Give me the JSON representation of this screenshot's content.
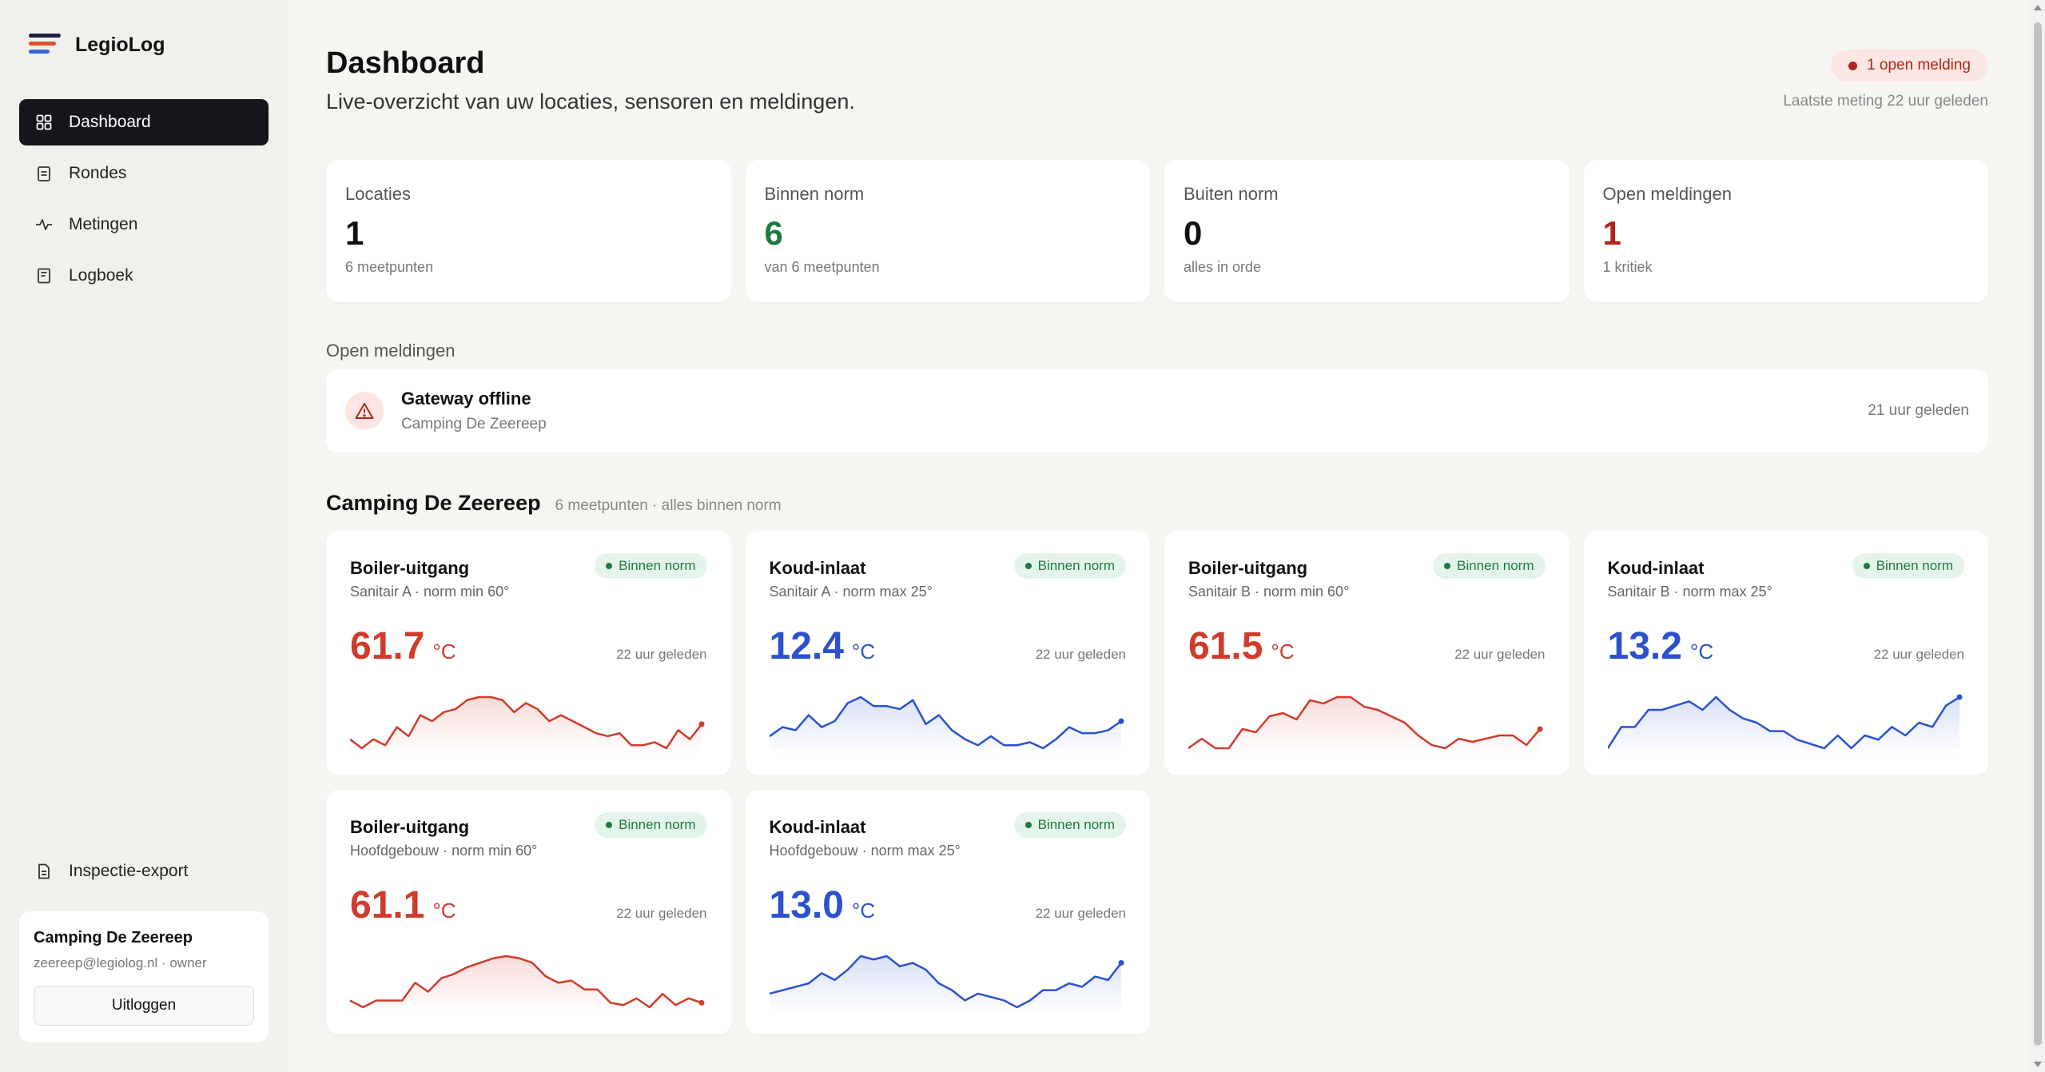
{
  "app": {
    "name": "LegioLog",
    "logo_colors": [
      "#1b1f3b",
      "#e0502f",
      "#3a63d6"
    ]
  },
  "sidebar": {
    "items": [
      {
        "label": "Dashboard",
        "icon": "grid-icon",
        "active": true
      },
      {
        "label": "Rondes",
        "icon": "clipboard-icon",
        "active": false
      },
      {
        "label": "Metingen",
        "icon": "pulse-icon",
        "active": false
      },
      {
        "label": "Logboek",
        "icon": "book-icon",
        "active": false
      }
    ],
    "export_label": "Inspectie-export",
    "user": {
      "name": "Camping De Zeereep",
      "meta": "zeereep@legiolog.nl · owner",
      "logout_label": "Uitloggen"
    }
  },
  "header": {
    "title": "Dashboard",
    "subtitle": "Live-overzicht van uw locaties, sensoren en meldingen.",
    "alert_pill": "1 open melding",
    "last_measurement": "Laatste meting 22 uur geleden"
  },
  "stats": [
    {
      "label": "Locaties",
      "value": "1",
      "sub": "6 meetpunten",
      "color": "#111111"
    },
    {
      "label": "Binnen norm",
      "value": "6",
      "sub": "van 6 meetpunten",
      "color": "#1d7a3e"
    },
    {
      "label": "Buiten norm",
      "value": "0",
      "sub": "alles in orde",
      "color": "#111111"
    },
    {
      "label": "Open meldingen",
      "value": "1",
      "sub": "1 kritiek",
      "color": "#b02519"
    }
  ],
  "notifications": {
    "section_label": "Open meldingen",
    "items": [
      {
        "title": "Gateway offline",
        "location": "Camping De Zeereep",
        "time": "21 uur geleden",
        "icon": "warning-icon"
      }
    ]
  },
  "location": {
    "title": "Camping De Zeereep",
    "subtitle": "6 meetpunten · alles binnen norm"
  },
  "sensors": [
    {
      "title": "Boiler-uitgang",
      "badge": "Binnen norm",
      "sub": "Sanitair A · norm min 60°",
      "value": "61.7",
      "unit": "°C",
      "time": "22 uur geleden",
      "kind": "warm",
      "trend": [
        59.9,
        59.6,
        59.9,
        59.7,
        60.3,
        60.0,
        60.7,
        60.5,
        60.8,
        60.9,
        61.2,
        61.3,
        61.3,
        61.2,
        60.8,
        61.1,
        60.9,
        60.5,
        60.7,
        60.5,
        60.3,
        60.1,
        60.0,
        60.1,
        59.7,
        59.7,
        59.8,
        59.6,
        60.2,
        59.9,
        60.4
      ]
    },
    {
      "title": "Koud-inlaat",
      "badge": "Binnen norm",
      "sub": "Sanitair A · norm max 25°",
      "value": "12.4",
      "unit": "°C",
      "time": "22 uur geleden",
      "kind": "cold",
      "trend": [
        12.2,
        12.5,
        12.4,
        12.9,
        12.5,
        12.7,
        13.3,
        13.5,
        13.2,
        13.2,
        13.1,
        13.4,
        12.6,
        12.9,
        12.4,
        12.1,
        11.9,
        12.2,
        11.9,
        11.9,
        12.0,
        11.8,
        12.1,
        12.5,
        12.3,
        12.3,
        12.4,
        12.7
      ]
    },
    {
      "title": "Boiler-uitgang",
      "badge": "Binnen norm",
      "sub": "Sanitair B · norm min 60°",
      "value": "61.5",
      "unit": "°C",
      "time": "22 uur geleden",
      "kind": "warm",
      "trend": [
        59.8,
        60.1,
        59.8,
        59.8,
        60.4,
        60.3,
        60.8,
        60.9,
        60.7,
        61.3,
        61.2,
        61.4,
        61.4,
        61.1,
        61.0,
        60.8,
        60.6,
        60.2,
        59.9,
        59.8,
        60.1,
        60.0,
        60.1,
        60.2,
        60.2,
        59.9,
        60.4
      ]
    },
    {
      "title": "Koud-inlaat",
      "badge": "Binnen norm",
      "sub": "Sanitair B · norm max 25°",
      "value": "13.2",
      "unit": "°C",
      "time": "22 uur geleden",
      "kind": "cold",
      "trend": [
        12.2,
        12.7,
        12.7,
        13.1,
        13.1,
        13.2,
        13.3,
        13.1,
        13.4,
        13.1,
        12.9,
        12.8,
        12.6,
        12.6,
        12.4,
        12.3,
        12.2,
        12.5,
        12.2,
        12.5,
        12.4,
        12.7,
        12.5,
        12.8,
        12.7,
        13.2,
        13.4
      ]
    },
    {
      "title": "Boiler-uitgang",
      "badge": "Binnen norm",
      "sub": "Hoofdgebouw · norm min 60°",
      "value": "61.1",
      "unit": "°C",
      "time": "22 uur geleden",
      "kind": "warm",
      "trend": [
        59.6,
        59.3,
        59.6,
        59.6,
        59.6,
        60.4,
        60.0,
        60.6,
        60.8,
        61.1,
        61.3,
        61.5,
        61.6,
        61.5,
        61.3,
        60.7,
        60.4,
        60.5,
        60.1,
        60.1,
        59.5,
        59.4,
        59.7,
        59.3,
        59.9,
        59.4,
        59.7,
        59.5
      ]
    },
    {
      "title": "Koud-inlaat",
      "badge": "Binnen norm",
      "sub": "Hoofdgebouw · norm max 25°",
      "value": "13.0",
      "unit": "°C",
      "time": "22 uur geleden",
      "kind": "cold",
      "trend": [
        12.2,
        12.3,
        12.4,
        12.5,
        12.8,
        12.6,
        12.9,
        13.3,
        13.2,
        13.3,
        13.0,
        13.1,
        12.9,
        12.5,
        12.3,
        12.0,
        12.2,
        12.1,
        12.0,
        11.8,
        12.0,
        12.3,
        12.3,
        12.5,
        12.4,
        12.7,
        12.6,
        13.1
      ]
    }
  ],
  "colors": {
    "warm": "#d13b2c",
    "cold": "#2b52cc",
    "ok": "#1d7a3e",
    "alert": "#b02519"
  }
}
